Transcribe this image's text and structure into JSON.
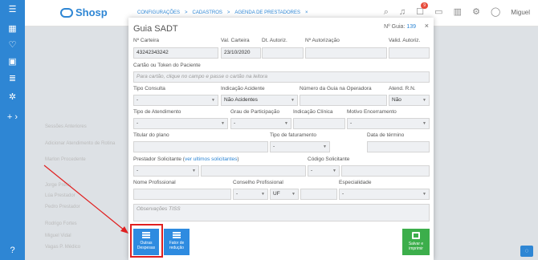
{
  "app": {
    "logo_text": "Shosp",
    "nav": [
      "CONFIGURAÇÕES",
      ">",
      "CADASTROS",
      ">",
      "AGENDA DE PRESTADORES",
      "×"
    ],
    "user_name": "Miguel",
    "notif_badge": "9"
  },
  "background": {
    "items": [
      "Sessões Anteriores",
      "Adicionar Atendimento de Rotina",
      "Marlon Procedente",
      "Jorge Prétio",
      "Lúa Prestador",
      "Pedro Prestador",
      "Rodrigo Fortes",
      "Miguel Vidal",
      "Vagas P. Médico"
    ]
  },
  "modal": {
    "title": "Guia SADT",
    "guia_label": "Nº Guia:",
    "guia_number": "139",
    "close": "×",
    "labels": {
      "carteira": "Nº Carteira",
      "val_carteira": "Val. Carteira",
      "dt_autoriz": "Dt. Autoriz.",
      "n_autorizacao": "Nº Autorização",
      "valid_autoriz": "Valid. Autoriz.",
      "cartao_token": "Cartão ou Token do Paciente",
      "tipo_consulta": "Tipo Consulta",
      "indicacao_acidente": "Indicação Acidente",
      "numero_guia_operadora": "Número da Guia na Operadora",
      "atend_rn": "Atend. R.N.",
      "tipo_atendimento": "Tipo de Atendimento",
      "grau_participacao": "Grau de Participação",
      "indicacao_clinica": "Indicação Clínica",
      "motivo_encerramento": "Motivo Encerramento",
      "titular_plano": "Titular do plano",
      "tipo_faturamento": "Tipo de faturamento",
      "data_termino": "Data de término",
      "prestador_solicitante": "Prestador Solicitante (",
      "ver_ultimos": "ver ultimos solicitantes",
      "prestador_close": ")",
      "codigo_solicitante": "Código Solicitante",
      "nome_profissional": "Nome Profissional",
      "conselho_profissional": "Conselho Profissional",
      "especialidade": "Especialidade"
    },
    "values": {
      "carteira": "43242343242",
      "val_carteira": "23/10/2020",
      "cartao_placeholder": "Para cartão, clique no campo e passe o cartão na leitora",
      "indicacao_acidente": "Não Acidentes",
      "atend_rn": "Não",
      "uf": "UF",
      "observacoes_placeholder": "Observações TISS",
      "dash": "-"
    },
    "buttons": {
      "outras_despesas": [
        "Outras",
        "Despesas"
      ],
      "fator_reducao": [
        "Fator de",
        "redução"
      ],
      "salvar_imprimir": [
        "Salvar e",
        "imprimir"
      ]
    }
  },
  "colors": {
    "primary": "#2e86d4",
    "green": "#3cae4b",
    "highlight": "#e02020"
  }
}
